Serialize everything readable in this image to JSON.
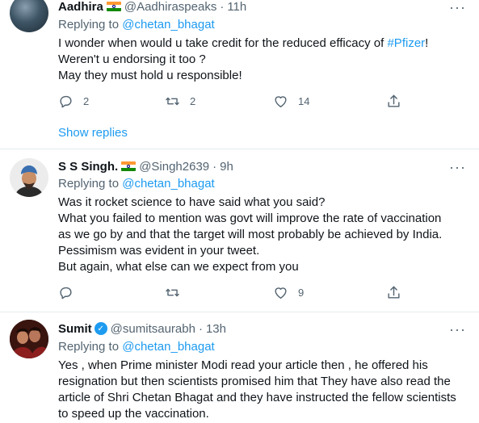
{
  "tweets": [
    {
      "name": "Aadhira",
      "handle": "@Aadhiraspeaks",
      "time": "11h",
      "reply_prefix": "Replying to",
      "reply_to": "@chetan_bhagat",
      "lines": [
        "I wonder when would u take credit for the reduced efficacy of ",
        "Weren't u endorsing it too ?",
        "May they must hold u responsible!"
      ],
      "hashtag": "#Pfizer",
      "line1_suffix": "!",
      "replies": "2",
      "retweets": "2",
      "likes": "14",
      "show_replies": "Show replies"
    },
    {
      "name": "S S Singh.",
      "handle": "@Singh2639",
      "time": "9h",
      "reply_prefix": "Replying to",
      "reply_to": "@chetan_bhagat",
      "lines": [
        "Was it rocket science to have said what you said?",
        "What you failed to mention was govt will improve the rate of vaccination",
        "as we go by and that the target will most probably be achieved by India.",
        "Pessimism was evident in your tweet.",
        "But again, what else can we expect from you"
      ],
      "replies": "",
      "retweets": "",
      "likes": "9"
    },
    {
      "name": "Sumit",
      "handle": "@sumitsaurabh",
      "time": "13h",
      "reply_prefix": "Replying to",
      "reply_to": "@chetan_bhagat",
      "lines": [
        "Yes , when Prime minister Modi read your article then , he offered his",
        "resignation but then scientists promised him that They have also read the",
        "article of Shri Chetan Bhagat and they have instructed the fellow scientists",
        "to speed up the vaccination."
      ]
    }
  ],
  "dot": "·",
  "more_icon": "···"
}
